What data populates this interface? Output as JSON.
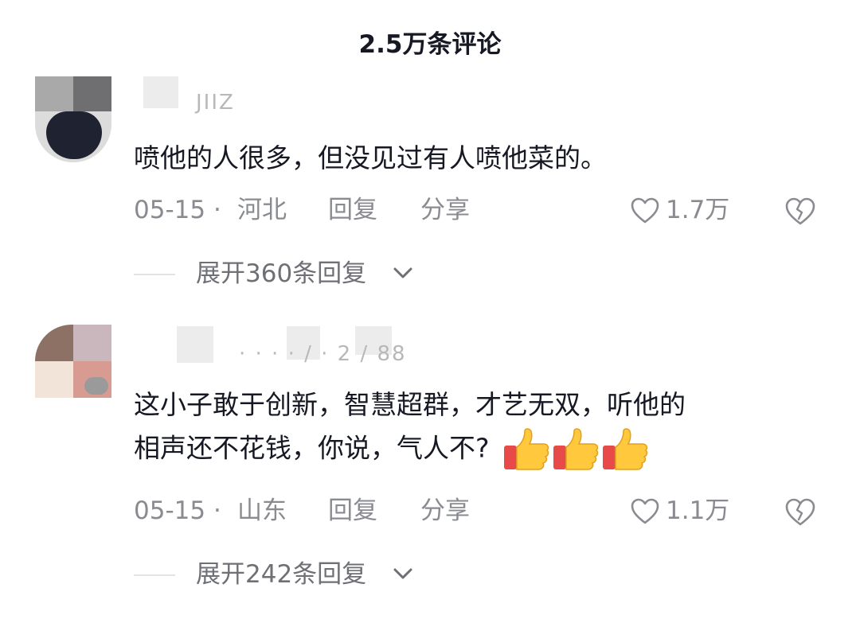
{
  "header": {
    "title": "2.5万条评论"
  },
  "comments": [
    {
      "username_partial": "JIIZ",
      "text_lines": [
        "喷他的人很多，但没见过有人喷他菜的。"
      ],
      "date": "05-15",
      "location": "河北",
      "reply_label": "回复",
      "share_label": "分享",
      "likes": "1.7万",
      "expand_label": "展开360条回复"
    },
    {
      "username_partial": "· · · · / · 2 / 88",
      "text_lines": [
        "这小子敢于创新，智慧超群，才艺无双，听他的",
        "相声还不花钱，你说，气人不?"
      ],
      "date": "05-15",
      "location": "山东",
      "reply_label": "回复",
      "share_label": "分享",
      "likes": "1.1万",
      "expand_label": "展开242条回复",
      "emoji": [
        "thumbs-up",
        "thumbs-up",
        "thumbs-up"
      ]
    }
  ],
  "meta_separator": "·",
  "colors": {
    "text": "#161823",
    "meta": "#8a8b91",
    "expand": "#6f7076"
  }
}
